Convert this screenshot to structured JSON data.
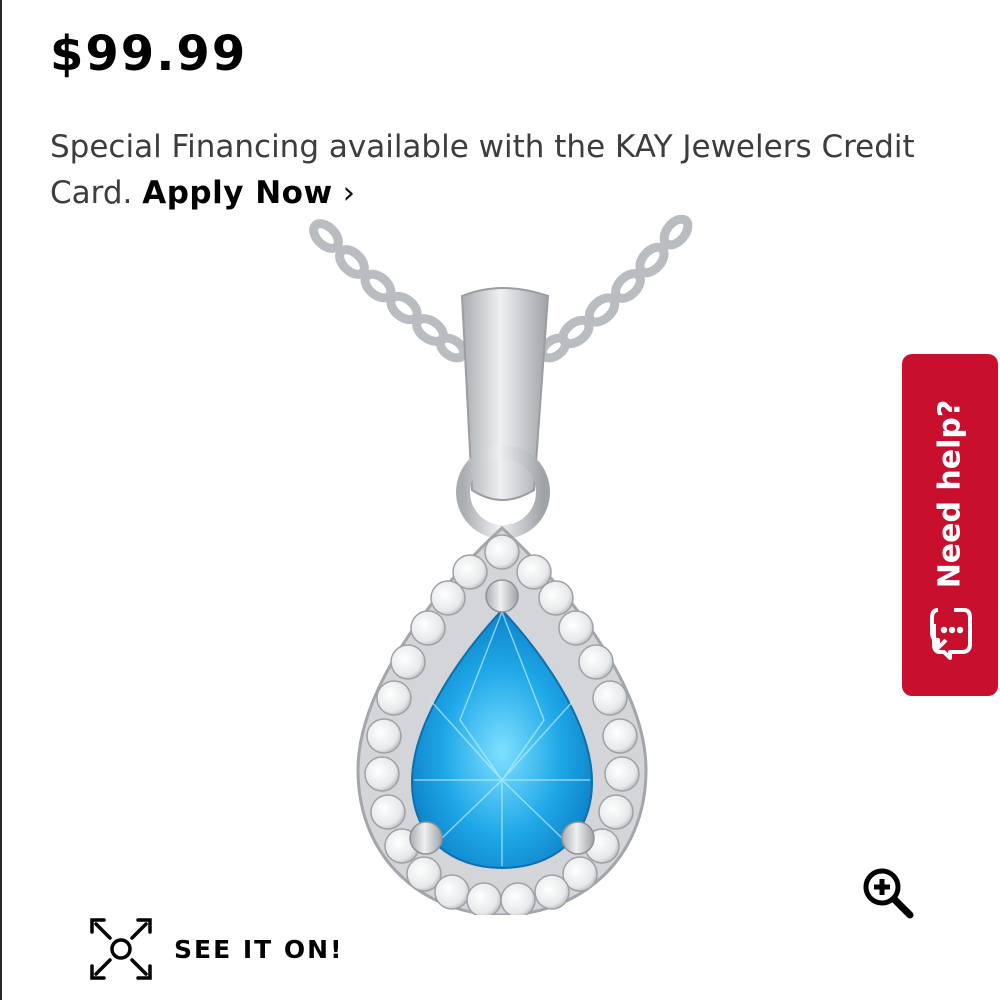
{
  "product": {
    "price": "$99.99",
    "financing_text": "Special Financing available with the KAY Jewelers Credit Card.",
    "apply_label": "Apply Now",
    "apply_chevron": "›",
    "image_icon": "pear-shaped-blue-topaz-halo-pendant-image",
    "stone_color": "#1ea7e8",
    "metal_color": "#c9cbce"
  },
  "help_tab": {
    "label": "Need help?",
    "icon": "chat-bubbles-icon",
    "color": "#c8102e"
  },
  "zoom": {
    "icon": "zoom-in-icon"
  },
  "see_it_on": {
    "label": "SEE IT ON!",
    "icon": "ar-scan-icon"
  }
}
